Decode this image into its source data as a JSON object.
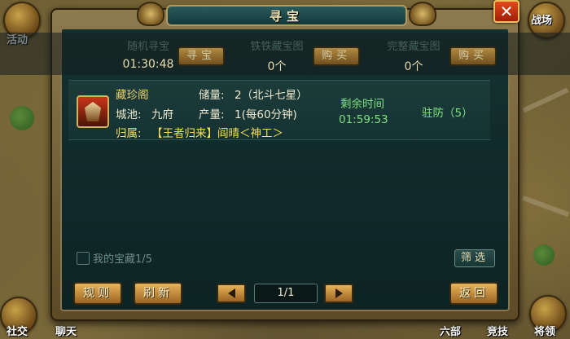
{
  "hud": {
    "left_top_label": "活动",
    "right_top_label": "战场",
    "bottom_left_label": "社交",
    "bottom_chat_label": "聊天",
    "bottom_mid_label": "六部",
    "bottom_compete_label": "竞技",
    "bottom_right_label": "将领"
  },
  "panel": {
    "title": "寻宝",
    "close_symbol": "✕"
  },
  "shops": [
    {
      "title": "随机寻宝",
      "value": "01:30:48",
      "button": "寻宝"
    },
    {
      "title": "铁铁藏宝图",
      "value": "0个",
      "button": "购买"
    },
    {
      "title": "完整藏宝图",
      "value": "0个",
      "button": "购买"
    }
  ],
  "treasure": {
    "name": "藏珍阁",
    "city_label": "城池:",
    "city_value": "九府",
    "storage_label": "储量:",
    "storage_value": "2（北斗七星）",
    "output_label": "产量:",
    "output_value": "1(每60分钟)",
    "owner_label": "归属:",
    "owner_value": "【王者归来】阎晴＜神工＞",
    "remaining_label": "剩余时间",
    "remaining_value": "01:59:53",
    "garrison": "驻防（5）"
  },
  "footer": {
    "my_treasure": "我的宝藏1/5",
    "filter": "筛选",
    "rules": "规则",
    "refresh": "刷新",
    "page": "1/1",
    "back": "返回"
  },
  "colors": {
    "panel_bg": "#10292a",
    "gold_button": "#d6a44a",
    "timer_green": "#7fe07f",
    "owner_yellow": "#f5e05a",
    "close_red": "#e24a1a"
  }
}
